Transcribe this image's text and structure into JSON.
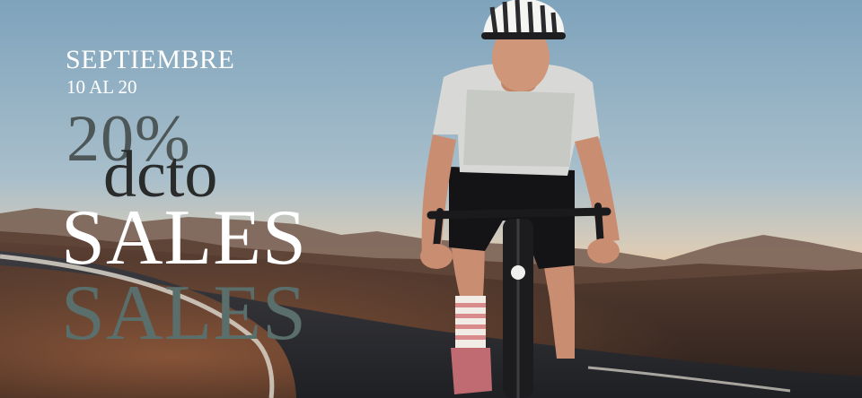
{
  "banner": {
    "month": "SEPTIEMBRE",
    "dates": "10 AL 20",
    "discount_percent": "20%",
    "discount_label": "dcto",
    "sales_primary": "SALES",
    "sales_secondary": "SALES"
  },
  "colors": {
    "sky_top": "#8fb0c6",
    "sky_horizon": "#e9c9a3",
    "mountains": "#6b5447",
    "road": "#2e2f33",
    "text_white": "#ffffff",
    "text_percent": "#4d5758",
    "text_dcto": "#2a2c2c",
    "text_sales_grey": "#5a6e6b"
  }
}
